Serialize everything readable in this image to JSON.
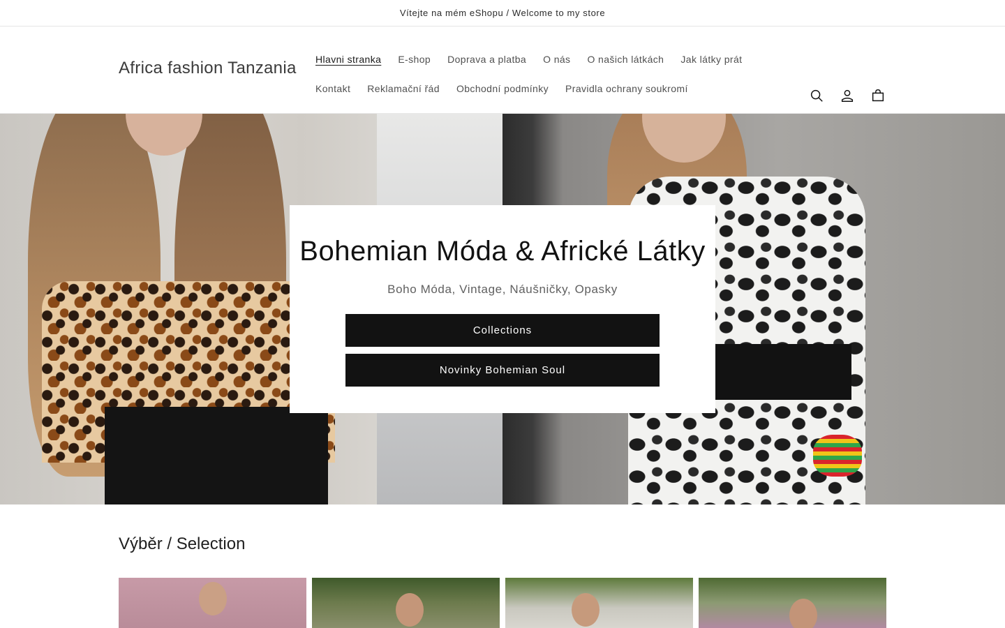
{
  "announcement": {
    "text": "Vítejte na mém eShopu / Welcome to my store"
  },
  "header": {
    "logo": "Africa fashion Tanzania",
    "nav_row1": [
      "Hlavni stranka",
      "E-shop",
      "Doprava a platba",
      "O nás",
      "O našich látkách",
      "Jak látky prát"
    ],
    "nav_row2": [
      "Kontakt",
      "Reklamační řád",
      "Obchodní podmínky",
      "Pravidla ochrany soukromí"
    ],
    "active_item": "Hlavni stranka",
    "icons": [
      "search-icon",
      "account-icon",
      "cart-icon"
    ]
  },
  "hero": {
    "title": "Bohemian Móda & Africké Látky",
    "subtitle": "Boho Móda, Vintage, Náušničky, Opasky",
    "buttons": [
      "Collections",
      "Novinky Bohemian Soul"
    ]
  },
  "selection": {
    "title": "Výběr / Selection"
  },
  "colors": {
    "button_bg": "#121212",
    "button_text": "#ffffff",
    "text_primary": "#121212"
  }
}
